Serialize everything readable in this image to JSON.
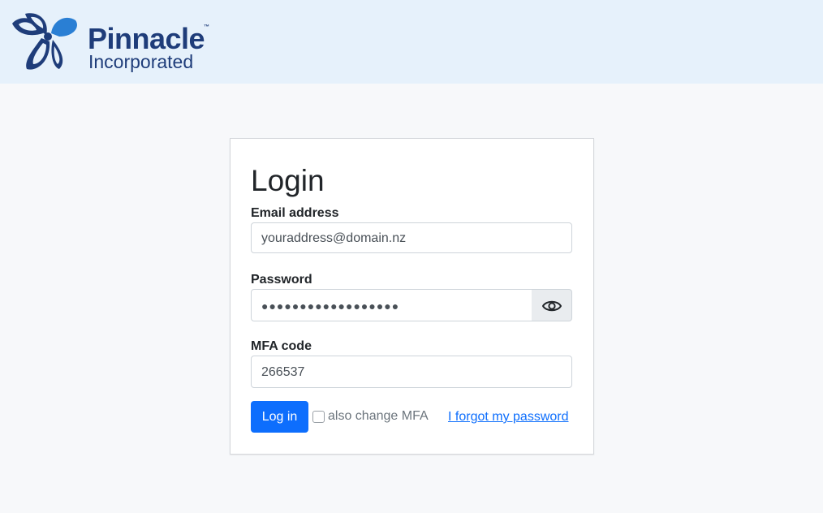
{
  "header": {
    "brand_name": "Pinnacle",
    "brand_trademark": "™",
    "brand_subtitle": "Incorporated",
    "logo_icon": "pinnacle-flower-logo",
    "background_color": "#e6f1fb"
  },
  "login_form": {
    "title": "Login",
    "email": {
      "label": "Email address",
      "value": "youraddress@domain.nz"
    },
    "password": {
      "label": "Password",
      "value": "●●●●●●●●●●●●●●●●●●",
      "toggle_icon": "eye-icon"
    },
    "mfa": {
      "label": "MFA code",
      "value": "266537"
    },
    "submit_label": "Log in",
    "also_change_mfa_label": "also change MFA",
    "also_change_mfa_checked": false,
    "forgot_password_label": "I forgot my password"
  },
  "colors": {
    "primary": "#0d6efd",
    "brand_navy": "#1f3d7a",
    "brand_blue": "#2a7fd4",
    "page_background": "#f7f8fa"
  }
}
